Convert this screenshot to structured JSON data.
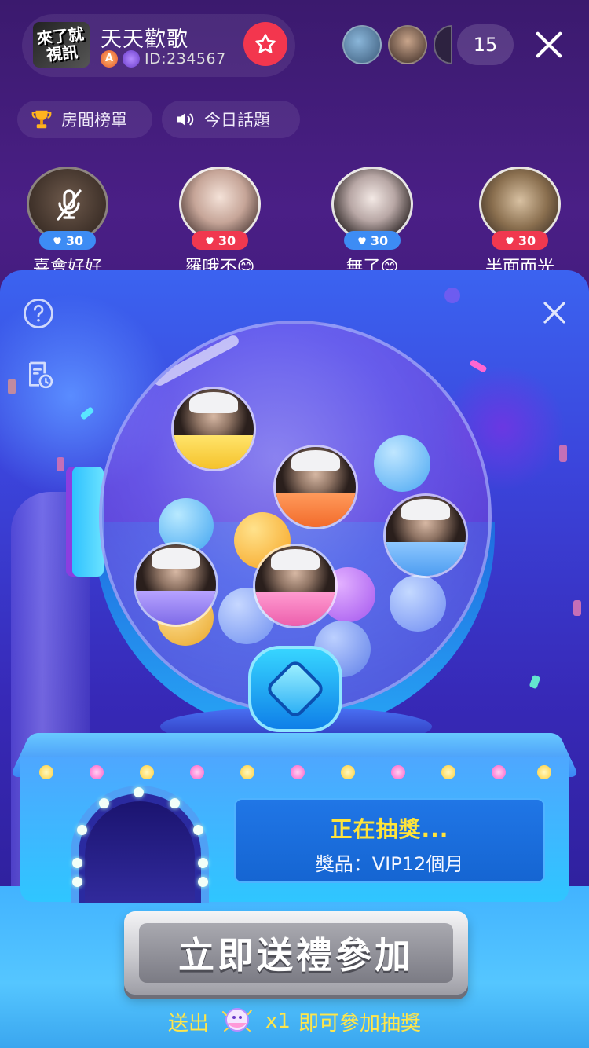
{
  "header": {
    "room_logo_text": "來了就\n視訊",
    "room_name": "天天歡歌",
    "room_id": "ID:234567",
    "viewer_count": "15"
  },
  "pills": {
    "rank_label": "房間榜單",
    "topic_label": "今日話題"
  },
  "seats": [
    {
      "name": "喜會好好",
      "hearts": "30",
      "badge_color": "#3d8cf4",
      "muted": true
    },
    {
      "name": "羅哦不😊",
      "hearts": "30",
      "badge_color": "#f0384f",
      "muted": false
    },
    {
      "name": "無了😊",
      "hearts": "30",
      "badge_color": "#3d8cf4",
      "muted": false
    },
    {
      "name": "半面而光",
      "hearts": "30",
      "badge_color": "#f0384f",
      "muted": false
    }
  ],
  "gacha": {
    "status": "正在抽獎...",
    "prize": "獎品：VIP12個月",
    "join_button": "立即送禮參加",
    "tip_prefix": "送出",
    "tip_count": "x1",
    "tip_suffix": "即可參加抽獎"
  },
  "colors": {
    "follow": "#f3364e",
    "status_text": "#ffe43a",
    "tip_text": "#ffe64a",
    "heart_blue": "#3d8cf4",
    "heart_red": "#f0384f"
  },
  "icons": {
    "help": "question-circle-icon",
    "record": "history-record-icon",
    "close": "close-icon",
    "follow": "star-icon",
    "rank": "trophy-icon",
    "topic": "speaker-icon",
    "mute": "mic-off-icon",
    "heart": "heart-icon",
    "gift": "gift-icon"
  }
}
